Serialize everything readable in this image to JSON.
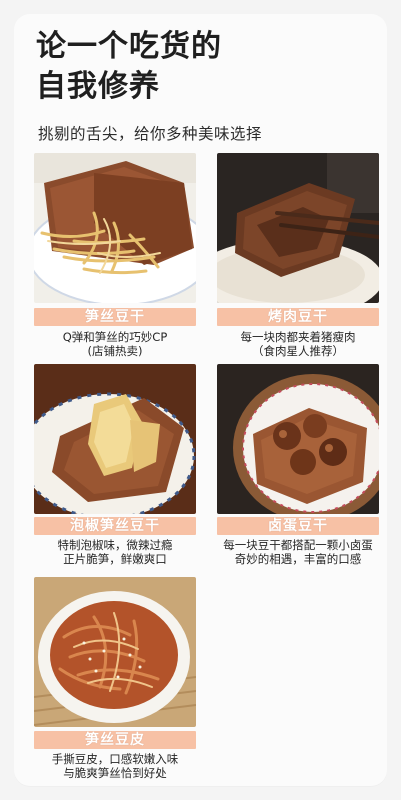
{
  "header": {
    "title_line1": "论一个吃货的",
    "title_line2": "自我修养",
    "subtitle": "挑剔的舌尖，给你多种美味选择"
  },
  "products": [
    {
      "name": "笋丝豆干",
      "desc": [
        "Q弹和笋丝的巧妙CP",
        "(店铺热卖)"
      ],
      "image": "tofu-with-bamboo-shoot-shreds"
    },
    {
      "name": "烤肉豆干",
      "desc": [
        "每一块肉都夹着猪瘦肉",
        "（食肉星人推荐）"
      ],
      "image": "roast-meat-tofu-held-by-chopsticks"
    },
    {
      "name": "泡椒笋丝豆干",
      "desc": [
        "特制泡椒味，微辣过瘾",
        "正片脆笋，鲜嫩爽口"
      ],
      "image": "pickled-pepper-tofu-with-bamboo-shoots"
    },
    {
      "name": "卤蛋豆干",
      "desc": [
        "每一块豆干都搭配一颗小卤蛋",
        "奇妙的相遇，丰富的口感"
      ],
      "image": "braised-egg-tofu-bowl"
    },
    {
      "name": "笋丝豆皮",
      "desc": [
        "手撕豆皮，口感软嫩入味",
        "与脆爽笋丝恰到好处"
      ],
      "image": "shredded-tofu-skin-with-bamboo-shoots"
    }
  ],
  "colors": {
    "label_bar": "#f7c1a5",
    "background": "#f4f4f4",
    "card": "#fbfbfb"
  }
}
